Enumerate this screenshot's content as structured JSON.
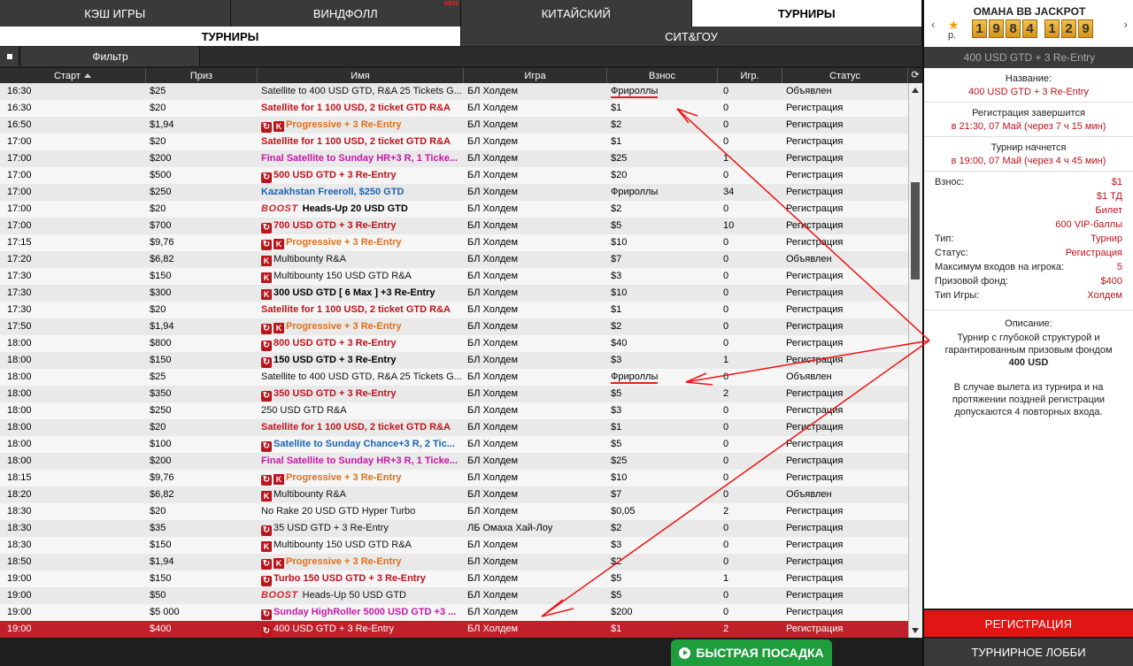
{
  "tabs": [
    "КЭШ ИГРЫ",
    "ВИНДФОЛЛ",
    "КИТАЙСКИЙ",
    "ТУРНИРЫ"
  ],
  "tab_badge": "NEW",
  "subtabs": [
    "ТУРНИРЫ",
    "СИТ&ГОУ"
  ],
  "filter_label": "Фильтр",
  "columns": [
    "Старт",
    "Приз",
    "Имя",
    "Игра",
    "Взнос",
    "Игр.",
    "Статус"
  ],
  "rows": [
    {
      "start": "16:30",
      "prize": "$25",
      "name": "Satellite to 400 USD GTD, R&A 25 Tickets G...",
      "style": "plain",
      "icons": [],
      "game": "БЛ Холдем",
      "fee": "Фрироллы",
      "players": "0",
      "status": "Объявлен",
      "mark": true
    },
    {
      "start": "16:30",
      "prize": "$20",
      "name": "Satellite for 1 100 USD, 2 ticket GTD R&A",
      "style": "red",
      "icons": [],
      "game": "БЛ Холдем",
      "fee": "$1",
      "players": "0",
      "status": "Регистрация"
    },
    {
      "start": "16:50",
      "prize": "$1,94",
      "name": "Progressive + 3 Re-Entry",
      "style": "orange",
      "icons": [
        "C",
        "K"
      ],
      "game": "БЛ Холдем",
      "fee": "$2",
      "players": "0",
      "status": "Регистрация"
    },
    {
      "start": "17:00",
      "prize": "$20",
      "name": "Satellite for 1 100 USD, 2 ticket GTD R&A",
      "style": "red",
      "icons": [],
      "game": "БЛ Холдем",
      "fee": "$1",
      "players": "0",
      "status": "Регистрация"
    },
    {
      "start": "17:00",
      "prize": "$200",
      "name": "Final Satellite to Sunday HR+3 R, 1 Ticke...",
      "style": "pink",
      "icons": [],
      "game": "БЛ Холдем",
      "fee": "$25",
      "players": "1",
      "status": "Регистрация"
    },
    {
      "start": "17:00",
      "prize": "$500",
      "name": "500 USD GTD + 3 Re-Entry",
      "style": "red",
      "icons": [
        "C"
      ],
      "game": "БЛ Холдем",
      "fee": "$20",
      "players": "0",
      "status": "Регистрация"
    },
    {
      "start": "17:00",
      "prize": "$250",
      "name": "Kazakhstan Freeroll, $250 GTD",
      "style": "blue",
      "icons": [],
      "game": "БЛ Холдем",
      "fee": "Фрироллы",
      "players": "34",
      "status": "Регистрация"
    },
    {
      "start": "17:00",
      "prize": "$20",
      "name": "Heads-Up 20 USD GTD",
      "style": "black",
      "icons": [],
      "boost": true,
      "game": "БЛ Холдем",
      "fee": "$2",
      "players": "0",
      "status": "Регистрация"
    },
    {
      "start": "17:00",
      "prize": "$700",
      "name": "700 USD GTD +  3 Re-Entry",
      "style": "red",
      "icons": [
        "C"
      ],
      "game": "БЛ Холдем",
      "fee": "$5",
      "players": "10",
      "status": "Регистрация"
    },
    {
      "start": "17:15",
      "prize": "$9,76",
      "name": "Progressive + 3 Re-Entry",
      "style": "orange",
      "icons": [
        "C",
        "K"
      ],
      "game": "БЛ Холдем",
      "fee": "$10",
      "players": "0",
      "status": "Регистрация"
    },
    {
      "start": "17:20",
      "prize": "$6,82",
      "name": "Multibounty  R&A",
      "style": "plain",
      "icons": [
        "K"
      ],
      "game": "БЛ Холдем",
      "fee": "$7",
      "players": "0",
      "status": "Объявлен"
    },
    {
      "start": "17:30",
      "prize": "$150",
      "name": "Multibounty 150 USD GTD R&A",
      "style": "plain",
      "icons": [
        "K"
      ],
      "game": "БЛ Холдем",
      "fee": "$3",
      "players": "0",
      "status": "Регистрация"
    },
    {
      "start": "17:30",
      "prize": "$300",
      "name": "300 USD GTD [ 6 Max ] +3 Re-Entry",
      "style": "black",
      "icons": [
        "K"
      ],
      "game": "БЛ Холдем",
      "fee": "$10",
      "players": "0",
      "status": "Регистрация"
    },
    {
      "start": "17:30",
      "prize": "$20",
      "name": "Satellite for 1 100 USD, 2 ticket GTD R&A",
      "style": "red",
      "icons": [],
      "game": "БЛ Холдем",
      "fee": "$1",
      "players": "0",
      "status": "Регистрация"
    },
    {
      "start": "17:50",
      "prize": "$1,94",
      "name": "Progressive + 3 Re-Entry",
      "style": "orange",
      "icons": [
        "C",
        "K"
      ],
      "game": "БЛ Холдем",
      "fee": "$2",
      "players": "0",
      "status": "Регистрация"
    },
    {
      "start": "18:00",
      "prize": "$800",
      "name": "800 USD GTD + 3 Re-Entry",
      "style": "red",
      "icons": [
        "C"
      ],
      "game": "БЛ Холдем",
      "fee": "$40",
      "players": "0",
      "status": "Регистрация"
    },
    {
      "start": "18:00",
      "prize": "$150",
      "name": "150 USD GTD + 3 Re-Entry",
      "style": "black",
      "icons": [
        "C"
      ],
      "game": "БЛ Холдем",
      "fee": "$3",
      "players": "1",
      "status": "Регистрация"
    },
    {
      "start": "18:00",
      "prize": "$25",
      "name": "Satellite to 400 USD GTD, R&A 25 Tickets G...",
      "style": "plain",
      "icons": [],
      "game": "БЛ Холдем",
      "fee": "Фрироллы",
      "players": "0",
      "status": "Объявлен",
      "mark": true
    },
    {
      "start": "18:00",
      "prize": "$350",
      "name": "350 USD GTD + 3 Re-Entry",
      "style": "red",
      "icons": [
        "C"
      ],
      "game": "БЛ Холдем",
      "fee": "$5",
      "players": "2",
      "status": "Регистрация"
    },
    {
      "start": "18:00",
      "prize": "$250",
      "name": "250 USD GTD R&A",
      "style": "plain",
      "icons": [],
      "game": "БЛ Холдем",
      "fee": "$3",
      "players": "0",
      "status": "Регистрация"
    },
    {
      "start": "18:00",
      "prize": "$20",
      "name": "Satellite for 1 100 USD, 2 ticket GTD R&A",
      "style": "red",
      "icons": [],
      "game": "БЛ Холдем",
      "fee": "$1",
      "players": "0",
      "status": "Регистрация"
    },
    {
      "start": "18:00",
      "prize": "$100",
      "name": "Satellite to Sunday Chance+3 R, 2 Tic...",
      "style": "blue",
      "icons": [
        "C"
      ],
      "game": "БЛ Холдем",
      "fee": "$5",
      "players": "0",
      "status": "Регистрация"
    },
    {
      "start": "18:00",
      "prize": "$200",
      "name": "Final Satellite to Sunday HR+3 R, 1 Ticke...",
      "style": "pink",
      "icons": [],
      "game": "БЛ Холдем",
      "fee": "$25",
      "players": "0",
      "status": "Регистрация"
    },
    {
      "start": "18:15",
      "prize": "$9,76",
      "name": "Progressive + 3 Re-Entry",
      "style": "orange",
      "icons": [
        "C",
        "K"
      ],
      "game": "БЛ Холдем",
      "fee": "$10",
      "players": "0",
      "status": "Регистрация"
    },
    {
      "start": "18:20",
      "prize": "$6,82",
      "name": "Multibounty  R&A",
      "style": "plain",
      "icons": [
        "K"
      ],
      "game": "БЛ Холдем",
      "fee": "$7",
      "players": "0",
      "status": "Объявлен"
    },
    {
      "start": "18:30",
      "prize": "$20",
      "name": "No Rake 20 USD GTD Hyper Turbo",
      "style": "plain",
      "icons": [],
      "game": "БЛ Холдем",
      "fee": "$0,05",
      "players": "2",
      "status": "Регистрация"
    },
    {
      "start": "18:30",
      "prize": "$35",
      "name": "35 USD GTD  + 3 Re-Entry",
      "style": "plain",
      "icons": [
        "C"
      ],
      "game": "ЛБ Омаха Хай-Лоу",
      "fee": "$2",
      "players": "0",
      "status": "Регистрация"
    },
    {
      "start": "18:30",
      "prize": "$150",
      "name": "Multibounty 150 USD GTD R&A",
      "style": "plain",
      "icons": [
        "K"
      ],
      "game": "БЛ Холдем",
      "fee": "$3",
      "players": "0",
      "status": "Регистрация"
    },
    {
      "start": "18:50",
      "prize": "$1,94",
      "name": "Progressive + 3 Re-Entry",
      "style": "orange",
      "icons": [
        "C",
        "K"
      ],
      "game": "БЛ Холдем",
      "fee": "$2",
      "players": "0",
      "status": "Регистрация"
    },
    {
      "start": "19:00",
      "prize": "$150",
      "name": "Turbo 150 USD GTD + 3 Re-Entry",
      "style": "red",
      "icons": [
        "C"
      ],
      "game": "БЛ Холдем",
      "fee": "$5",
      "players": "1",
      "status": "Регистрация"
    },
    {
      "start": "19:00",
      "prize": "$50",
      "name": "Heads-Up 50 USD GTD",
      "style": "plain",
      "icons": [],
      "boost": true,
      "game": "БЛ Холдем",
      "fee": "$5",
      "players": "0",
      "status": "Регистрация"
    },
    {
      "start": "19:00",
      "prize": "$5 000",
      "name": "Sunday HighRoller 5000 USD GTD +3 ...",
      "style": "pink",
      "icons": [
        "C"
      ],
      "game": "БЛ Холдем",
      "fee": "$200",
      "players": "0",
      "status": "Регистрация"
    },
    {
      "start": "19:00",
      "prize": "$400",
      "name": "400 USD GTD + 3 Re-Entry",
      "style": "plain",
      "icons": [
        "C"
      ],
      "game": "БЛ Холдем",
      "fee": "$1",
      "players": "2",
      "status": "Регистрация",
      "selected": true
    }
  ],
  "boost_label": "BOOST",
  "quick_seat": "БЫСТРАЯ ПОСАДКА",
  "jackpot": {
    "title": "ОМАНА ВВ JACKPOT",
    "currency": "р.",
    "digits": [
      "1",
      "9",
      "8",
      "4",
      "1",
      "2",
      "9"
    ]
  },
  "selected_title": "400 USD GTD + 3 Re-Entry",
  "details": {
    "name_label": "Название:",
    "name_value": "400 USD GTD + 3 Re-Entry",
    "reg_end_label": "Регистрация завершится",
    "reg_end_value": "в 21:30, 07 Май (через 7 ч 15 мин)",
    "start_label": "Турнир начнется",
    "start_value": "в 19:00, 07 Май (через 4 ч 45 мин)",
    "fee_label": "Взнос:",
    "fee_values": [
      "$1",
      "$1 ТД",
      "Билет",
      "600 VIP-баллы"
    ],
    "kv": [
      {
        "k": "Тип:",
        "v": "Турнир"
      },
      {
        "k": "Статус:",
        "v": "Регистрация"
      },
      {
        "k": "Максимум входов на игрока:",
        "v": "5"
      },
      {
        "k": "Призовой фонд:",
        "v": "$400"
      },
      {
        "k": "Тип Игры:",
        "v": "Холдем"
      }
    ],
    "desc_label": "Описание:",
    "desc_text": "Турнир с глубокой структурой и гарантированным призовым фондом",
    "desc_bold": "400 USD",
    "desc_text2": "В случае вылета из турнира и на протяжении поздней регистрации допускаются 4 повторных входа."
  },
  "register_button": "РЕГИСТРАЦИЯ",
  "lobby_button": "ТУРНИРНОЕ ЛОББИ",
  "colors": {
    "accent_red": "#e21515",
    "row_selected": "#c0202a",
    "quick_green": "#1f9c3c",
    "jackpot_gold": "#f4c24a"
  }
}
